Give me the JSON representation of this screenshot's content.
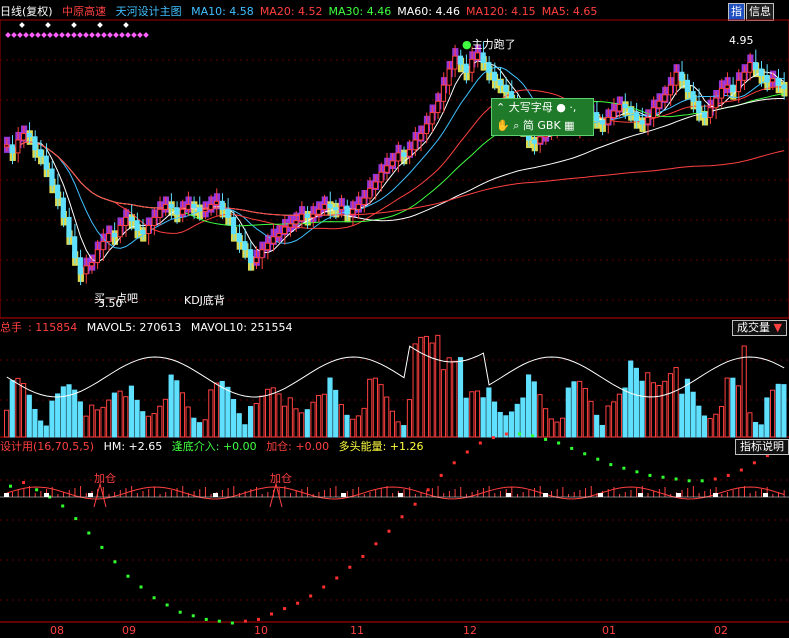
{
  "header": {
    "period": "日线(复权)",
    "stock": "中原高速",
    "indicator": "天河设计主图",
    "ma": [
      {
        "label": "MA10: 4.58",
        "color": "#40c0ff"
      },
      {
        "label": "MA20: 4.52",
        "color": "#ff4040"
      },
      {
        "label": "MA30: 4.46",
        "color": "#40ff40"
      },
      {
        "label": "MA60: 4.46",
        "color": "#ffffff"
      },
      {
        "label": "MA120: 4.15",
        "color": "#ff4040"
      },
      {
        "label": "MA5: 4.65",
        "color": "#ff4040"
      }
    ],
    "btn_zhi": "指",
    "btn_info": "信息"
  },
  "annotations": {
    "main_run": "主力跑了",
    "high": "4.95",
    "low": "3.50",
    "buy": "买一点吧",
    "kdj": "KDJ底背"
  },
  "popup": {
    "row1": "大写字母",
    "row2": "简 GBK"
  },
  "volume": {
    "label": "总手",
    "value": "115854",
    "mavol5": "MAVOL5: 270613",
    "mavol10": "MAVOL10: 251554",
    "button": "成交量"
  },
  "indicator2": {
    "name": "设计用(16,70,5,5)",
    "hm": "HM: +2.65",
    "bottom": "逢底介入: +0.00",
    "add": "加仓: +0.00",
    "energy": "多头能量: +1.26",
    "button": "指标说明",
    "add_marker": "加仓"
  },
  "xaxis": [
    "08",
    "09",
    "10",
    "11",
    "12",
    "01",
    "02"
  ],
  "chart_data": {
    "type": "candlestick",
    "title": "中原高速 日线(复权)",
    "price_range": [
      3.5,
      4.95
    ],
    "series": [
      {
        "name": "MA10",
        "last": 4.58
      },
      {
        "name": "MA20",
        "last": 4.52
      },
      {
        "name": "MA30",
        "last": 4.46
      },
      {
        "name": "MA60",
        "last": 4.46
      },
      {
        "name": "MA120",
        "last": 4.15
      },
      {
        "name": "MA5",
        "last": 4.65
      }
    ],
    "volume": {
      "last": 115854,
      "MAVOL5": 270613,
      "MAVOL10": 251554
    },
    "months": [
      "08",
      "09",
      "10",
      "11",
      "12",
      "01",
      "02"
    ],
    "close": [
      4.35,
      4.3,
      4.38,
      4.42,
      4.4,
      4.32,
      4.28,
      4.2,
      4.1,
      4.02,
      3.9,
      3.78,
      3.65,
      3.55,
      3.6,
      3.62,
      3.7,
      3.75,
      3.8,
      3.78,
      3.85,
      3.9,
      3.88,
      3.82,
      3.8,
      3.85,
      3.9,
      3.95,
      3.98,
      3.96,
      3.92,
      3.95,
      3.98,
      3.96,
      3.94,
      3.95,
      3.98,
      4.0,
      3.95,
      3.9,
      3.8,
      3.75,
      3.7,
      3.62,
      3.65,
      3.7,
      3.74,
      3.78,
      3.8,
      3.84,
      3.86,
      3.88,
      3.92,
      3.9,
      3.92,
      3.95,
      3.98,
      3.96,
      3.95,
      3.97,
      3.92,
      3.95,
      3.98,
      4.02,
      4.08,
      4.12,
      4.18,
      4.22,
      4.25,
      4.3,
      4.28,
      4.32,
      4.38,
      4.42,
      4.48,
      4.55,
      4.62,
      4.72,
      4.82,
      4.9,
      4.85,
      4.8,
      4.88,
      4.92,
      4.86,
      4.8,
      4.75,
      4.72,
      4.68,
      4.62,
      4.58,
      4.45,
      4.38,
      4.36,
      4.4,
      4.42,
      4.46,
      4.5,
      4.52,
      4.48,
      4.46,
      4.5,
      4.52,
      4.55,
      4.5,
      4.48,
      4.52,
      4.56,
      4.6,
      4.58,
      4.55,
      4.5,
      4.48,
      4.52,
      4.58,
      4.62,
      4.66,
      4.72,
      4.8,
      4.75,
      4.68,
      4.62,
      4.55,
      4.52,
      4.58,
      4.64,
      4.7,
      4.72,
      4.68,
      4.75,
      4.8,
      4.86,
      4.82,
      4.78,
      4.74,
      4.76,
      4.72,
      4.7
    ],
    "indicator_hm": [
      0.6,
      0.8,
      0.4,
      0.0,
      -0.5,
      -1.2,
      -2.0,
      -2.8,
      -3.6,
      -4.4,
      -5.0,
      -5.6,
      -6.0,
      -6.4,
      -6.6,
      -6.8,
      -6.9,
      -7.0,
      -6.9,
      -6.8,
      -6.5,
      -6.2,
      -5.9,
      -5.5,
      -5.0,
      -4.5,
      -3.9,
      -3.3,
      -2.6,
      -1.9,
      -1.1,
      -0.4,
      0.4,
      1.2,
      1.9,
      2.5,
      3.0,
      3.3,
      3.5,
      3.5,
      3.4,
      3.2,
      3.0,
      2.7,
      2.4,
      2.1,
      1.8,
      1.6,
      1.4,
      1.2,
      1.1,
      1.0,
      0.9,
      0.9,
      1.0,
      1.2,
      1.5,
      1.9,
      2.3,
      2.65
    ]
  }
}
